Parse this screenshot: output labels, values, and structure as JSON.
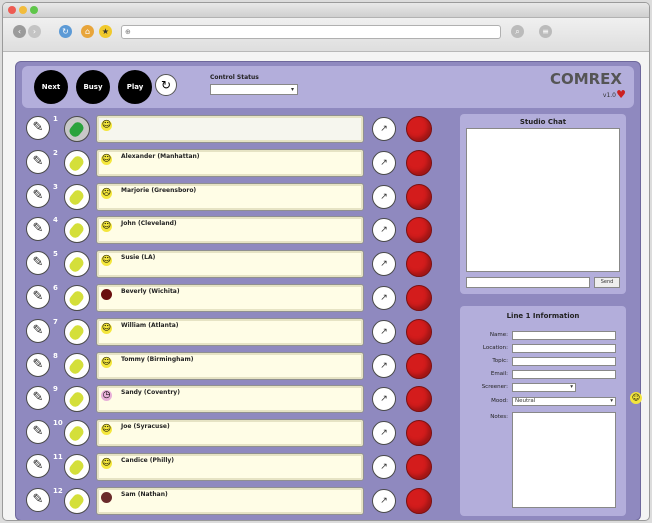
{
  "window": {
    "title": "",
    "address": "",
    "bookmarks": [
      "",
      "",
      ""
    ]
  },
  "header": {
    "buttons": [
      {
        "label": "Next",
        "icon": "next-icon"
      },
      {
        "label": "Busy",
        "icon": "busy-icon"
      },
      {
        "label": "Play",
        "icon": "play-icon"
      }
    ],
    "refresh_icon": "↻",
    "control_label": "Control Status",
    "control_value": "",
    "logo": "COMREX",
    "version": "v1.0"
  },
  "lines": [
    {
      "number": "1",
      "name": "",
      "time": "",
      "note": "",
      "face": "happy",
      "face_color": "#f4e63c",
      "active": true
    },
    {
      "number": "2",
      "name": "Alexander (Manhattan)",
      "time": "",
      "note": "",
      "face": "happy",
      "face_color": "#f4e63c"
    },
    {
      "number": "3",
      "name": "Marjorie (Greensboro)",
      "time": "",
      "note": "",
      "face": "sad",
      "face_color": "#f4e63c"
    },
    {
      "number": "4",
      "name": "John (Cleveland)",
      "time": "",
      "note": "",
      "face": "happy",
      "face_color": "#f4e63c"
    },
    {
      "number": "5",
      "name": "Susie (LA)",
      "time": "",
      "note": "",
      "face": "happy",
      "face_color": "#f4e63c"
    },
    {
      "number": "6",
      "name": "Beverly (Wichita)",
      "time": "",
      "note": "",
      "face": "dark",
      "face_color": "#6a0f0f"
    },
    {
      "number": "7",
      "name": "William (Atlanta)",
      "time": "",
      "note": "",
      "face": "happy",
      "face_color": "#f4e63c"
    },
    {
      "number": "8",
      "name": "Tommy (Birmingham)",
      "time": "",
      "note": "",
      "face": "happy",
      "face_color": "#f4e63c"
    },
    {
      "number": "9",
      "name": "Sandy (Coventry)",
      "time": "",
      "note": "",
      "face": "clock",
      "face_color": "#e8b0d8"
    },
    {
      "number": "10",
      "name": "Joe (Syracuse)",
      "time": "",
      "note": "",
      "face": "happy",
      "face_color": "#f4e63c"
    },
    {
      "number": "11",
      "name": "Candice (Philly)",
      "time": "",
      "note": "",
      "face": "happy",
      "face_color": "#f4e63c"
    },
    {
      "number": "12",
      "name": "Sam (Nathan)",
      "time": "",
      "note": "",
      "face": "dark",
      "face_color": "#6a2a2a"
    }
  ],
  "chat": {
    "title": "Studio Chat",
    "message": "",
    "send_label": "Send"
  },
  "info": {
    "title": "Line 1 Information",
    "fields": [
      {
        "label": "Name:",
        "value": ""
      },
      {
        "label": "Location:",
        "value": ""
      },
      {
        "label": "Topic:",
        "value": ""
      },
      {
        "label": "Email:",
        "value": ""
      }
    ],
    "screener_label": "Screener:",
    "screener_value": "",
    "mood_label": "Mood:",
    "mood_value": "Neutral",
    "notes_label": "Notes:"
  },
  "colors": {
    "panel_bg": "#8f89bf",
    "panel_light": "#b3aedb",
    "end_call_red": "#d41c1c",
    "hold_green": "#d4df3a"
  }
}
